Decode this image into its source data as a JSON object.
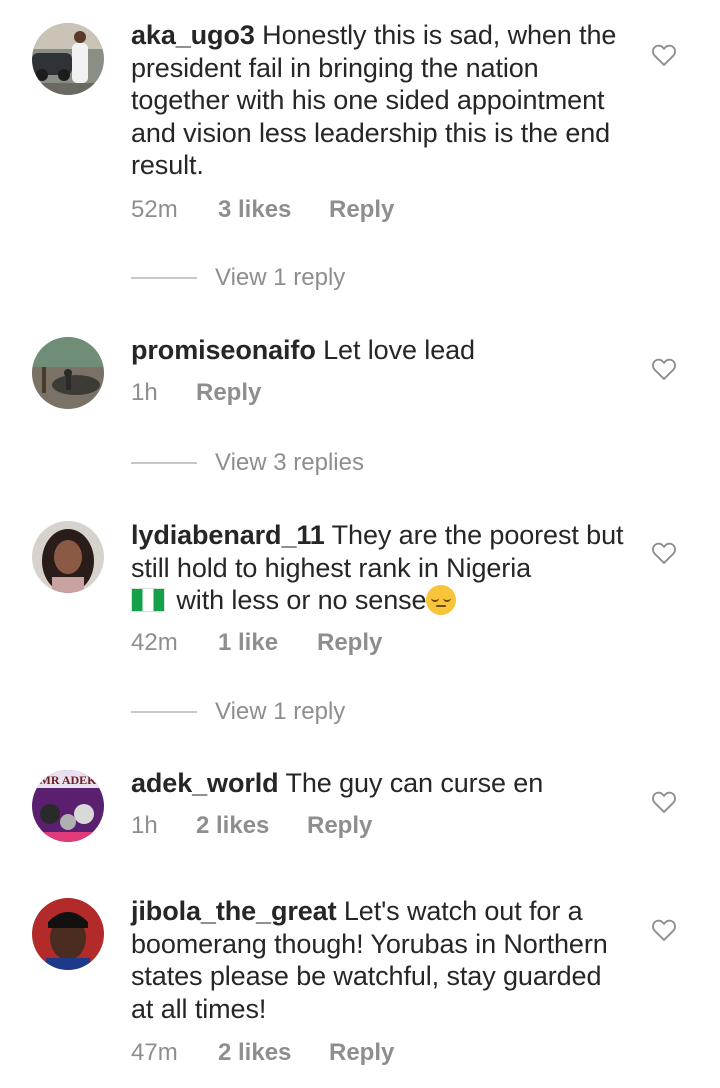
{
  "comments": [
    {
      "username": "aka_ugo3",
      "text": " Honestly this is sad, when the president fail in bringing the nation together with his one sided appointment and vision less leadership this is the end result.",
      "time": "52m",
      "likes": "3 likes",
      "reply": "Reply",
      "view_replies": "View 1 reply"
    },
    {
      "username": "promiseonaifo",
      "text": " Let love lead",
      "time": "1h",
      "likes": "",
      "reply": "Reply",
      "view_replies": "View 3 replies"
    },
    {
      "username": "lydiabenard_11",
      "text": " They are the poorest but still hold to highest rank in Nigeria",
      "text_after_flag": " with less or no sense",
      "time": "42m",
      "likes": "1 like",
      "reply": "Reply",
      "view_replies": "View 1 reply"
    },
    {
      "username": "adek_world",
      "text": " The guy can curse en",
      "time": "1h",
      "likes": "2 likes",
      "reply": "Reply",
      "avatar_text": "MR ADEK"
    },
    {
      "username": "jibola_the_great",
      "text": " Let's watch out for a boomerang though! Yorubas in Northern states please be watchful, stay guarded at all times!",
      "time": "47m",
      "likes": "2 likes",
      "reply": "Reply"
    }
  ],
  "icons": {
    "like": "heart-outline-icon",
    "flag": "nigeria-flag-icon",
    "emoji": "pensive-face-icon"
  },
  "colors": {
    "text": "#262626",
    "secondary": "#8e8e8e",
    "divider": "#c7c7c7"
  }
}
